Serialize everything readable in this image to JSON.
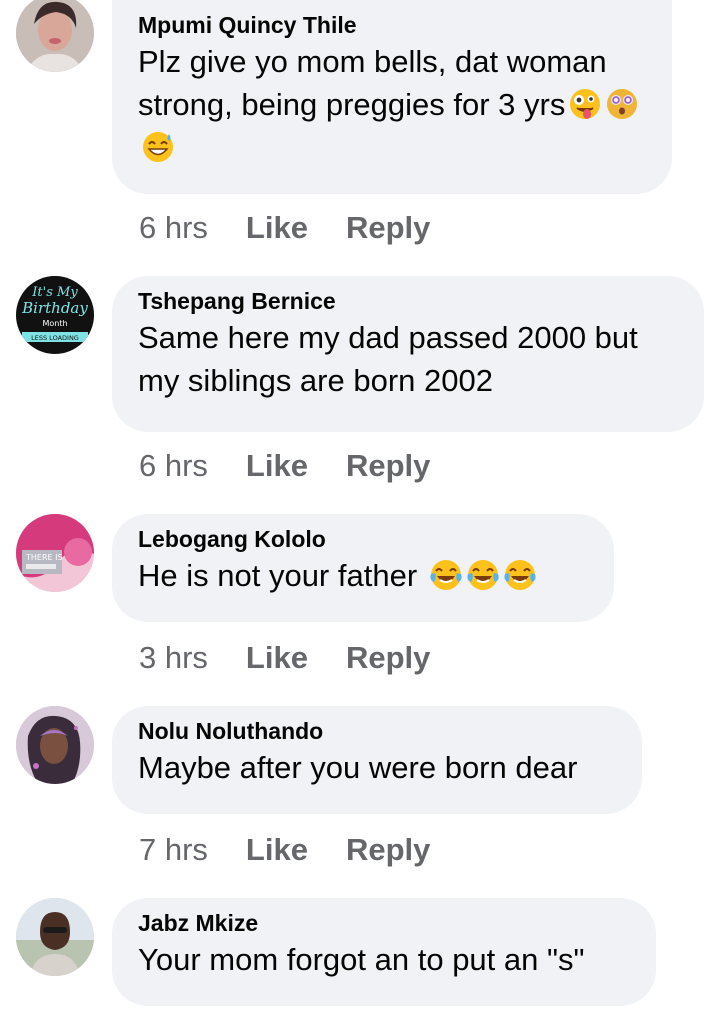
{
  "comments": [
    {
      "author": "Mpumi Quincy Thile",
      "text": "Plz give yo mom bells, dat woman strong, being preggies for 3 yrs",
      "emojis": [
        "zany-face-emoji",
        "dizzy-face-emoji",
        "grinning-sweat-emoji"
      ],
      "time": "6 hrs",
      "like": "Like",
      "reply": "Reply"
    },
    {
      "author": "Tshepang Bernice",
      "text": "Same here my dad passed 2000 but my siblings are born 2002",
      "emojis": [],
      "avatar_text": [
        "It's My",
        "Birthday",
        "Month",
        "LESS LOADING"
      ],
      "time": "6 hrs",
      "like": "Like",
      "reply": "Reply"
    },
    {
      "author": "Lebogang Kololo",
      "text": "He is not your father",
      "emojis": [
        "tears-of-joy-emoji",
        "tears-of-joy-emoji",
        "tears-of-joy-emoji"
      ],
      "avatar_text": [
        "THERE IS"
      ],
      "time": "3 hrs",
      "like": "Like",
      "reply": "Reply"
    },
    {
      "author": "Nolu Noluthando",
      "text": "Maybe after you were born dear",
      "emojis": [],
      "time": "7 hrs",
      "like": "Like",
      "reply": "Reply"
    },
    {
      "author": "Jabz Mkize",
      "text": "Your mom forgot an to put an \"s\"",
      "emojis": []
    }
  ],
  "colors": {
    "bubble": "#f0f2f5",
    "meta": "#65676b",
    "text": "#050505"
  }
}
